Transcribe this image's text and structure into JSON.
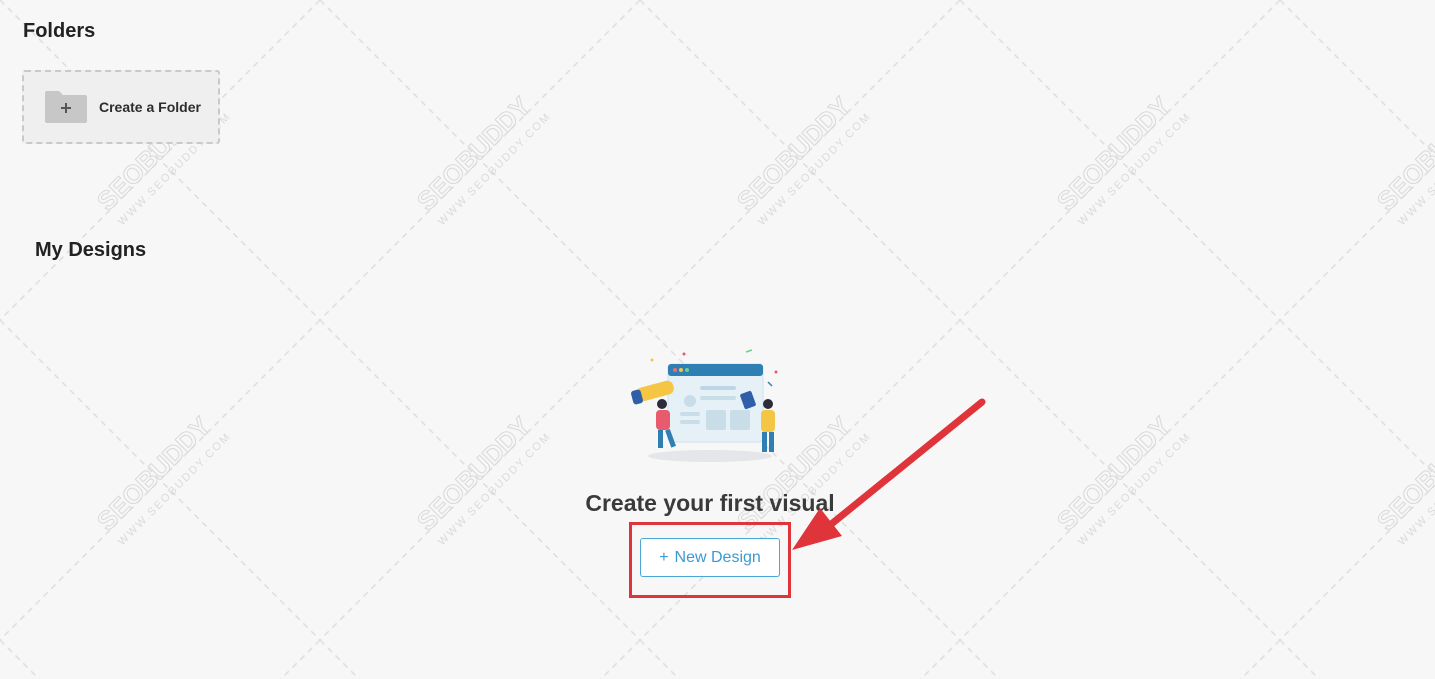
{
  "folders": {
    "title": "Folders",
    "create_label": "Create a Folder"
  },
  "designs": {
    "title": "My Designs",
    "empty_state": {
      "heading": "Create your first visual",
      "button_icon": "+",
      "button_label": "New Design"
    }
  },
  "annotation": {
    "highlight_color": "#e0343b"
  },
  "watermark": {
    "brand": "SEOBUDDY",
    "url": "WWW.SEOBUDDY.COM"
  },
  "colors": {
    "accent": "#3a9bd2",
    "background": "#f7f7f7"
  }
}
